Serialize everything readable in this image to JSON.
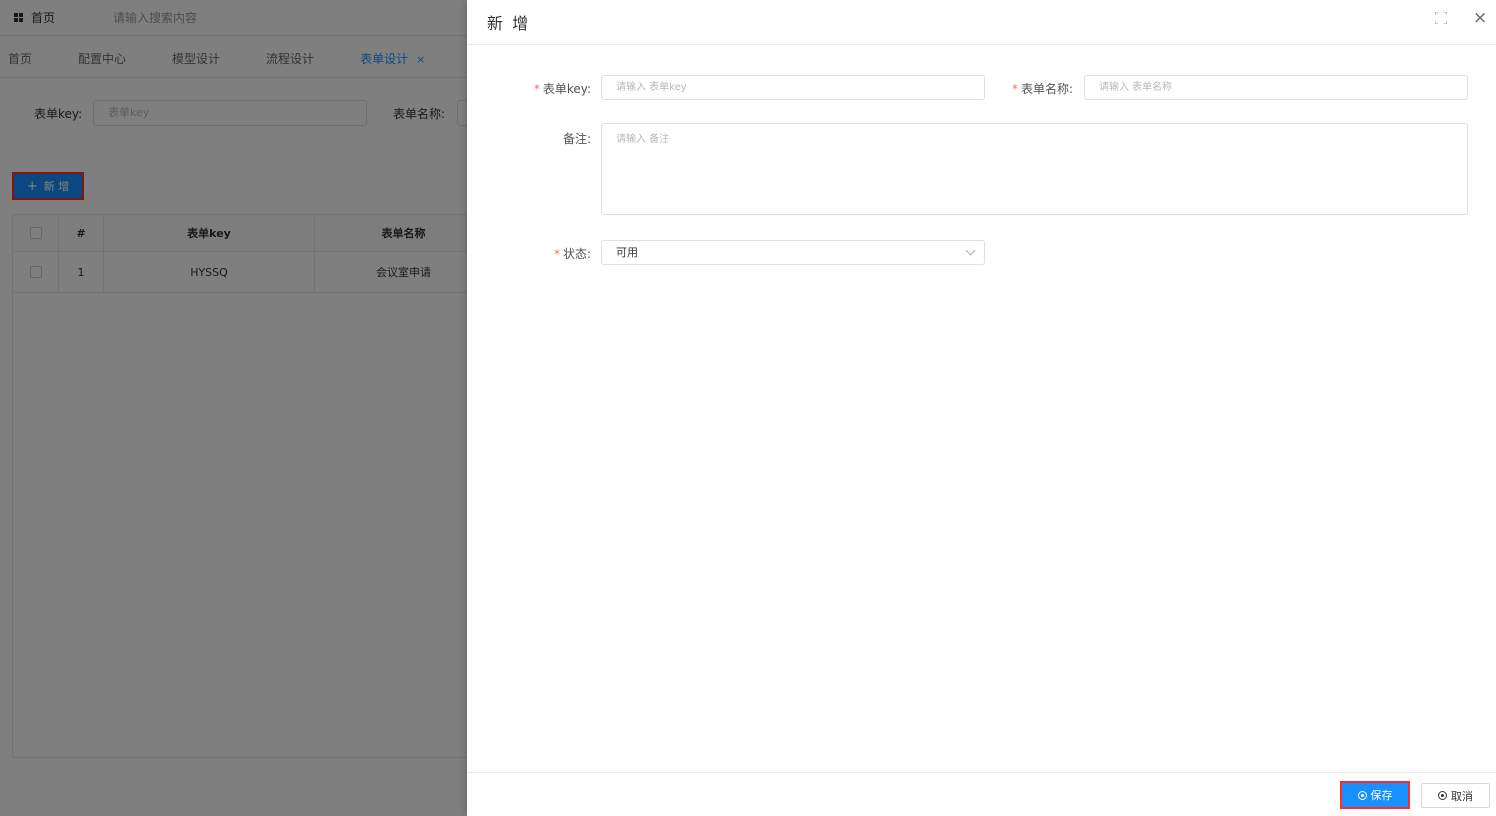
{
  "topbar": {
    "home_label": "首页",
    "search_placeholder": "请输入搜索内容"
  },
  "tabs": [
    {
      "label": "首页"
    },
    {
      "label": "配置中心"
    },
    {
      "label": "模型设计"
    },
    {
      "label": "流程设计"
    },
    {
      "label": "表单设计",
      "active": true,
      "close": "×"
    }
  ],
  "filter": {
    "key_label": "表单key:",
    "key_placeholder": "表单key",
    "name_label": "表单名称:"
  },
  "toolbar": {
    "add_plus": "+",
    "add_label": "新 增"
  },
  "table": {
    "headers": [
      "#",
      "表单key",
      "表单名称"
    ],
    "rows": [
      {
        "index": "1",
        "key": "HYSSQ",
        "name": "会议室申请"
      }
    ]
  },
  "drawer": {
    "title": "新 增",
    "close": "×",
    "form": {
      "key_label": "表单key:",
      "key_placeholder": "请输入 表单key",
      "name_label": "表单名称:",
      "name_placeholder": "请输入 表单名称",
      "remark_label": "备注:",
      "remark_placeholder": "请输入 备注",
      "status_label": "状态:",
      "status_value": "可用",
      "required_mark": "*"
    },
    "footer": {
      "save_label": "保存",
      "cancel_label": "取消"
    }
  },
  "colors": {
    "primary": "#1890ff",
    "highlight": "#ff2b2b",
    "required": "#f56c6c"
  }
}
